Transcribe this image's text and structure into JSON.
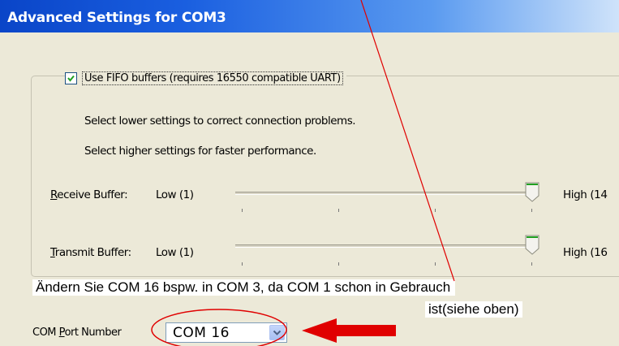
{
  "window": {
    "title": "Advanced Settings for COM3"
  },
  "fifo": {
    "checkbox_label": "Use FIFO buffers (requires 16550 compatible UART)",
    "checked": true,
    "hint_lower": "Select lower settings to correct connection problems.",
    "hint_higher": "Select higher settings for faster performance."
  },
  "receive_buffer": {
    "label": "Receive Buffer:",
    "low_label": "Low (1)",
    "high_label": "High (14",
    "level": 1.0
  },
  "transmit_buffer": {
    "label": "Transmit Buffer:",
    "low_label": "Low (1)",
    "high_label": "High (16",
    "level": 1.0
  },
  "annotation": {
    "line1": "Ändern Sie COM 16 bspw. in COM 3, da COM 1 schon in Gebrauch",
    "line2": "ist(siehe oben)",
    "color": "#e00000"
  },
  "com_port": {
    "label": "COM Port Number",
    "selected": "COM 16"
  },
  "icons": {
    "checkbox": "check-icon",
    "combo": "chevron-down-icon",
    "slider": "slider-thumb-icon"
  }
}
